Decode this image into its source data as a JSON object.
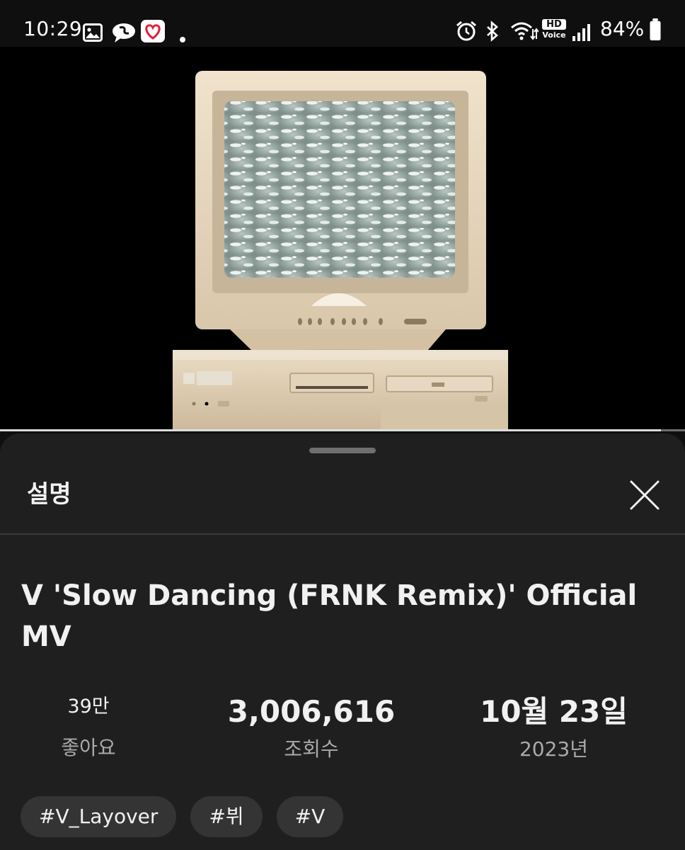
{
  "status_bar": {
    "time": "10:29",
    "battery_percent": "84%",
    "icons": [
      "gallery-icon",
      "chat-bubble-icon",
      "heart-badge-icon",
      "notification-dot-icon",
      "alarm-icon",
      "bluetooth-icon",
      "wifi-icon",
      "hd-voice-icon",
      "signal-icon",
      "battery-icon"
    ],
    "hd_label": "HD",
    "voice_label": "Voice"
  },
  "player": {
    "progress": 0.965
  },
  "description_sheet": {
    "title": "설명",
    "close_icon": "close-icon",
    "video_title": "V 'Slow Dancing (FRNK Remix)' Official MV",
    "stats": {
      "likes": {
        "value": "39만",
        "label": "좋아요"
      },
      "views": {
        "value": "3,006,616",
        "label": "조회수"
      },
      "date": {
        "value": "10월 23일",
        "label": "2023년"
      }
    },
    "tags": [
      "#V_Layover",
      "#뷔",
      "#V"
    ]
  },
  "colors": {
    "background": "#0f0f0f",
    "sheet": "#1f1f1f",
    "tag_chip": "#343434",
    "secondary_text": "#aaaaaa"
  }
}
